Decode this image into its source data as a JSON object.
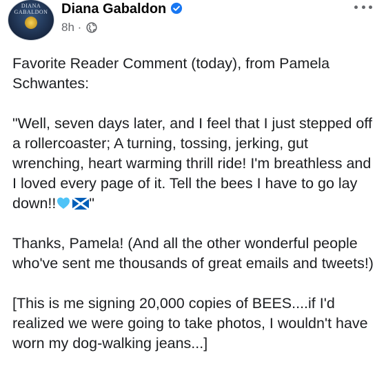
{
  "post": {
    "author": "Diana Gabaldon",
    "time": "8h",
    "separator": "·",
    "avatar_text": "DIANA GABALDON",
    "paragraphs": [
      "Favorite Reader Comment (today), from Pamela Schwantes:",
      "\"Well, seven days later, and I feel that I just stepped off a rollercoaster; A turning, tossing, jerking, gut wrenching, heart warming thrill ride! I'm breathless and I loved every page of it. Tell the bees I have to go lay down!!",
      "\"",
      "Thanks, Pamela!  (And all the other wonderful people who've sent me thousands of great emails and tweets!)",
      "[This is me signing 20,000 copies of BEES....if I'd realized we were going to take photos, I wouldn't have worn my dog-walking jeans...]"
    ],
    "emoji": [
      "blue-heart",
      "scotland-flag"
    ],
    "colors": {
      "verified_blue": "#1877f2",
      "heart_blue": "#4fc3f7",
      "flag_blue": "#005eb8",
      "meta_gray": "#65676b"
    }
  }
}
